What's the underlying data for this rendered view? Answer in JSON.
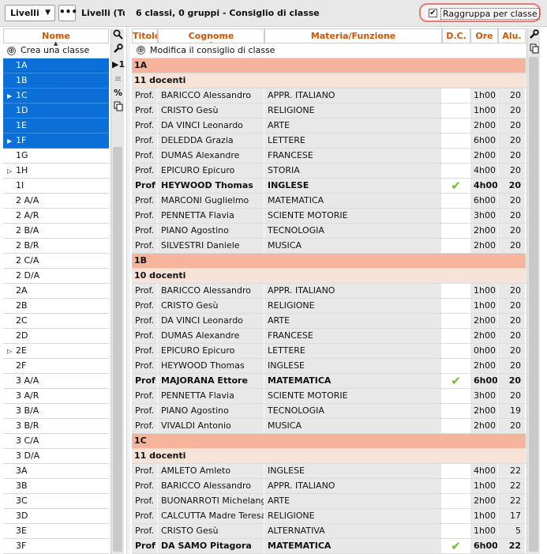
{
  "toolbar": {
    "dropdown_label": "Livelli",
    "more_label": "•••",
    "levels_title": "Livelli (Tutti)",
    "summary": "6 classi, 0 gruppi - Consiglio di classe",
    "group_checkbox_label": "Raggruppa per classe",
    "group_checked": "✔"
  },
  "left": {
    "header": "Nome",
    "sort_arrow": "▲",
    "create_label": "Crea una classe",
    "create_icon": "⊕",
    "items": [
      {
        "label": "1A",
        "selected": true,
        "tri": ""
      },
      {
        "label": "1B",
        "selected": true,
        "tri": ""
      },
      {
        "label": "1C",
        "selected": true,
        "tri": "▶"
      },
      {
        "label": "1D",
        "selected": true,
        "tri": ""
      },
      {
        "label": "1E",
        "selected": true,
        "tri": ""
      },
      {
        "label": "1F",
        "selected": true,
        "tri": "▶"
      },
      {
        "label": "1G",
        "selected": false,
        "tri": ""
      },
      {
        "label": "1H",
        "selected": false,
        "tri": "▷"
      },
      {
        "label": "1I",
        "selected": false,
        "tri": ""
      },
      {
        "label": "2 A/A",
        "selected": false,
        "tri": ""
      },
      {
        "label": "2 A/R",
        "selected": false,
        "tri": ""
      },
      {
        "label": "2 B/A",
        "selected": false,
        "tri": ""
      },
      {
        "label": "2 B/R",
        "selected": false,
        "tri": ""
      },
      {
        "label": "2 C/A",
        "selected": false,
        "tri": ""
      },
      {
        "label": "2 D/A",
        "selected": false,
        "tri": ""
      },
      {
        "label": "2A",
        "selected": false,
        "tri": ""
      },
      {
        "label": "2B",
        "selected": false,
        "tri": ""
      },
      {
        "label": "2C",
        "selected": false,
        "tri": ""
      },
      {
        "label": "2D",
        "selected": false,
        "tri": ""
      },
      {
        "label": "2E",
        "selected": false,
        "tri": "▷"
      },
      {
        "label": "2F",
        "selected": false,
        "tri": ""
      },
      {
        "label": "3 A/A",
        "selected": false,
        "tri": ""
      },
      {
        "label": "3 A/R",
        "selected": false,
        "tri": ""
      },
      {
        "label": "3 B/A",
        "selected": false,
        "tri": ""
      },
      {
        "label": "3 B/R",
        "selected": false,
        "tri": ""
      },
      {
        "label": "3 C/A",
        "selected": false,
        "tri": ""
      },
      {
        "label": "3 D/A",
        "selected": false,
        "tri": ""
      },
      {
        "label": "3A",
        "selected": false,
        "tri": ""
      },
      {
        "label": "3B",
        "selected": false,
        "tri": ""
      },
      {
        "label": "3C",
        "selected": false,
        "tri": ""
      },
      {
        "label": "3D",
        "selected": false,
        "tri": ""
      },
      {
        "label": "3E",
        "selected": false,
        "tri": ""
      },
      {
        "label": "3F",
        "selected": false,
        "tri": ""
      }
    ]
  },
  "left_tools": [
    "⚲",
    "🔧",
    "▶1",
    "≡",
    "%",
    "⧉"
  ],
  "right_tools": [
    "🔧",
    "⧉"
  ],
  "grid": {
    "headers": {
      "titolo": "Titolo",
      "cognome": "Cognome",
      "materia": "Materia/Funzione",
      "dc": "D.C.",
      "ore": "Ore",
      "alu": "Alu."
    },
    "sort_arrow": "▲",
    "modify_label": "Modifica il consiglio di classe",
    "modify_icon": "⊕",
    "rows": [
      {
        "kind": "group",
        "text": "1A"
      },
      {
        "kind": "sub",
        "text": "11 docenti"
      },
      {
        "kind": "data",
        "tit": "Prof.",
        "cog": "BARICCO Alessandro",
        "mat": "APPR. ITALIANO",
        "dc": "",
        "ore": "1h00",
        "alu": "20",
        "bold": false
      },
      {
        "kind": "data",
        "tit": "Prof.",
        "cog": "CRISTO Gesù",
        "mat": "RELIGIONE",
        "dc": "",
        "ore": "1h00",
        "alu": "20",
        "bold": false
      },
      {
        "kind": "data",
        "tit": "Prof.",
        "cog": "DA VINCI Leonardo",
        "mat": "ARTE",
        "dc": "",
        "ore": "2h00",
        "alu": "20",
        "bold": false
      },
      {
        "kind": "data",
        "tit": "Prof.",
        "cog": "DELEDDA Grazia",
        "mat": "LETTERE",
        "dc": "",
        "ore": "6h00",
        "alu": "20",
        "bold": false
      },
      {
        "kind": "data",
        "tit": "Prof.",
        "cog": "DUMAS Alexandre",
        "mat": "FRANCESE",
        "dc": "",
        "ore": "2h00",
        "alu": "20",
        "bold": false
      },
      {
        "kind": "data",
        "tit": "Prof.",
        "cog": "EPICURO Epicuro",
        "mat": "STORIA",
        "dc": "",
        "ore": "4h00",
        "alu": "20",
        "bold": false
      },
      {
        "kind": "data",
        "tit": "Prof",
        "cog": "HEYWOOD Thomas",
        "mat": "INGLESE",
        "dc": "✔",
        "ore": "4h00",
        "alu": "20",
        "bold": true
      },
      {
        "kind": "data",
        "tit": "Prof.",
        "cog": "MARCONI Guglielmo",
        "mat": "MATEMATICA",
        "dc": "",
        "ore": "6h00",
        "alu": "20",
        "bold": false
      },
      {
        "kind": "data",
        "tit": "Prof.",
        "cog": "PENNETTA Flavia",
        "mat": "SCIENTE MOTORIE",
        "dc": "",
        "ore": "3h00",
        "alu": "20",
        "bold": false
      },
      {
        "kind": "data",
        "tit": "Prof.",
        "cog": "PIANO Agostino",
        "mat": "TECNOLOGIA",
        "dc": "",
        "ore": "2h00",
        "alu": "20",
        "bold": false
      },
      {
        "kind": "data",
        "tit": "Prof.",
        "cog": "SILVESTRI Daniele",
        "mat": "MUSICA",
        "dc": "",
        "ore": "2h00",
        "alu": "20",
        "bold": false
      },
      {
        "kind": "group",
        "text": "1B"
      },
      {
        "kind": "sub",
        "text": "10 docenti"
      },
      {
        "kind": "data",
        "tit": "Prof.",
        "cog": "BARICCO Alessandro",
        "mat": "APPR. ITALIANO",
        "dc": "",
        "ore": "1h00",
        "alu": "20",
        "bold": false
      },
      {
        "kind": "data",
        "tit": "Prof.",
        "cog": "CRISTO Gesù",
        "mat": "RELIGIONE",
        "dc": "",
        "ore": "1h00",
        "alu": "20",
        "bold": false
      },
      {
        "kind": "data",
        "tit": "Prof.",
        "cog": "DA VINCI Leonardo",
        "mat": "ARTE",
        "dc": "",
        "ore": "2h00",
        "alu": "20",
        "bold": false
      },
      {
        "kind": "data",
        "tit": "Prof.",
        "cog": "DUMAS Alexandre",
        "mat": "FRANCESE",
        "dc": "",
        "ore": "2h00",
        "alu": "20",
        "bold": false
      },
      {
        "kind": "data",
        "tit": "Prof.",
        "cog": "EPICURO Epicuro",
        "mat": "LETTERE",
        "dc": "",
        "ore": "0h00",
        "alu": "20",
        "bold": false
      },
      {
        "kind": "data",
        "tit": "Prof.",
        "cog": "HEYWOOD Thomas",
        "mat": "INGLESE",
        "dc": "",
        "ore": "2h00",
        "alu": "20",
        "bold": false
      },
      {
        "kind": "data",
        "tit": "Prof",
        "cog": "MAJORANA Ettore",
        "mat": "MATEMATICA",
        "dc": "✔",
        "ore": "6h00",
        "alu": "20",
        "bold": true
      },
      {
        "kind": "data",
        "tit": "Prof.",
        "cog": "PENNETTA Flavia",
        "mat": "SCIENTE MOTORIE",
        "dc": "",
        "ore": "3h00",
        "alu": "20",
        "bold": false
      },
      {
        "kind": "data",
        "tit": "Prof.",
        "cog": "PIANO Agostino",
        "mat": "TECNOLOGIA",
        "dc": "",
        "ore": "2h00",
        "alu": "19",
        "bold": false
      },
      {
        "kind": "data",
        "tit": "Prof.",
        "cog": "VIVALDI Antonio",
        "mat": "MUSICA",
        "dc": "",
        "ore": "2h00",
        "alu": "20",
        "bold": false
      },
      {
        "kind": "group",
        "text": "1C"
      },
      {
        "kind": "sub",
        "text": "11 docenti"
      },
      {
        "kind": "data",
        "tit": "Prof.",
        "cog": "AMLETO Amleto",
        "mat": "INGLESE",
        "dc": "",
        "ore": "4h00",
        "alu": "22",
        "bold": false
      },
      {
        "kind": "data",
        "tit": "Prof.",
        "cog": "BARICCO Alessandro",
        "mat": "APPR. ITALIANO",
        "dc": "",
        "ore": "1h00",
        "alu": "22",
        "bold": false
      },
      {
        "kind": "data",
        "tit": "Prof.",
        "cog": "BUONARROTI Michelangel",
        "mat": "ARTE",
        "dc": "",
        "ore": "2h00",
        "alu": "22",
        "bold": false
      },
      {
        "kind": "data",
        "tit": "Prof.",
        "cog": "CALCUTTA Madre Teresa",
        "mat": "RELIGIONE",
        "dc": "",
        "ore": "1h00",
        "alu": "17",
        "bold": false
      },
      {
        "kind": "data",
        "tit": "Prof.",
        "cog": "CRISTO Gesù",
        "mat": "ALTERNATIVA",
        "dc": "",
        "ore": "1h00",
        "alu": "5",
        "bold": false
      },
      {
        "kind": "data",
        "tit": "Prof",
        "cog": "DA SAMO Pitagora",
        "mat": "MATEMATICA",
        "dc": "✔",
        "ore": "6h00",
        "alu": "22",
        "bold": true
      }
    ]
  },
  "colors": {
    "accent": "#d35400",
    "selected": "#0a6fd6",
    "group_bg": "#f5b49b",
    "sub_bg": "#f7e2d8",
    "check": "#6fbe2a",
    "highlight": "#e87a72"
  }
}
